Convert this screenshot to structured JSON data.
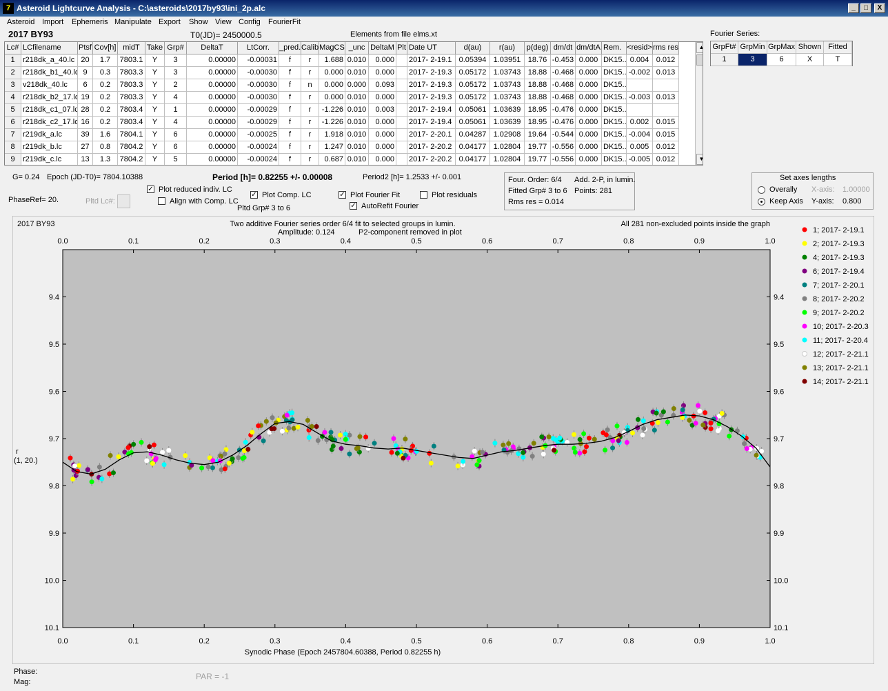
{
  "window": {
    "title": "Asteroid Lightcurve Analysis - C:\\asteroids\\2017by93\\ini_2p.alc",
    "icon": "7",
    "min": "_",
    "max": "□",
    "close": "X"
  },
  "menu": [
    "Asteroid",
    "Import",
    "Ephemeris",
    "Manipulate",
    "Export",
    "Show",
    "View",
    "Config",
    "FourierFit"
  ],
  "header": {
    "asteroid": "2017 BY93",
    "t0": "T0(JD)= 2450000.5",
    "elements": "Elements from file elms.xt"
  },
  "table": {
    "columns": [
      "Lc#",
      "LCfilename",
      "Ptsf",
      "Cov[h]",
      "midT",
      "Take",
      "Grp#",
      "DeltaT",
      "LtCorr.",
      "_pred.",
      "Calib.",
      "MagCS",
      "_unc",
      "DeltaM",
      "Plt",
      "Date UT",
      "d(au)",
      "r(au)",
      "p(deg)",
      "dm/dt",
      "dm/dtA",
      "Rem.",
      "<resid>",
      "rms res"
    ],
    "rows": [
      [
        "1",
        "r218dk_a_40.lc",
        "20",
        "1.7",
        "7803.1",
        "Y",
        "3",
        "0.00000",
        "-0.00031",
        "f",
        "r",
        "1.688",
        "0.010",
        "0.000",
        "",
        "2017- 2-19.1",
        "0.05394",
        "1.03951",
        "18.76",
        "-0.453",
        "0.000",
        "DK15..",
        "0.004",
        "0.012"
      ],
      [
        "2",
        "r218dk_b1_40.lc",
        "9",
        "0.3",
        "7803.3",
        "Y",
        "3",
        "0.00000",
        "-0.00030",
        "f",
        "r",
        "0.000",
        "0.010",
        "0.000",
        "",
        "2017- 2-19.3",
        "0.05172",
        "1.03743",
        "18.88",
        "-0.468",
        "0.000",
        "DK15..",
        "-0.002",
        "0.013"
      ],
      [
        "3",
        "v218dk_40.lc",
        "6",
        "0.2",
        "7803.3",
        "Y",
        "2",
        "0.00000",
        "-0.00030",
        "f",
        "n",
        "0.000",
        "0.000",
        "0.093",
        "",
        "2017- 2-19.3",
        "0.05172",
        "1.03743",
        "18.88",
        "-0.468",
        "0.000",
        "DK15..",
        "",
        ""
      ],
      [
        "4",
        "r218dk_b2_17.lc",
        "19",
        "0.2",
        "7803.3",
        "Y",
        "4",
        "0.00000",
        "-0.00030",
        "f",
        "r",
        "0.000",
        "0.010",
        "0.000",
        "",
        "2017- 2-19.3",
        "0.05172",
        "1.03743",
        "18.88",
        "-0.468",
        "0.000",
        "DK15..",
        "-0.003",
        "0.013"
      ],
      [
        "5",
        "r218dk_c1_07.lc",
        "28",
        "0.2",
        "7803.4",
        "Y",
        "1",
        "0.00000",
        "-0.00029",
        "f",
        "r",
        "-1.226",
        "0.010",
        "0.003",
        "",
        "2017- 2-19.4",
        "0.05061",
        "1.03639",
        "18.95",
        "-0.476",
        "0.000",
        "DK15..",
        "",
        ""
      ],
      [
        "6",
        "r218dk_c2_17.lc",
        "16",
        "0.2",
        "7803.4",
        "Y",
        "4",
        "0.00000",
        "-0.00029",
        "f",
        "r",
        "-1.226",
        "0.010",
        "0.000",
        "",
        "2017- 2-19.4",
        "0.05061",
        "1.03639",
        "18.95",
        "-0.476",
        "0.000",
        "DK15..",
        "0.002",
        "0.015"
      ],
      [
        "7",
        "r219dk_a.lc",
        "39",
        "1.6",
        "7804.1",
        "Y",
        "6",
        "0.00000",
        "-0.00025",
        "f",
        "r",
        "1.918",
        "0.010",
        "0.000",
        "",
        "2017- 2-20.1",
        "0.04287",
        "1.02908",
        "19.64",
        "-0.544",
        "0.000",
        "DK15..",
        "-0.004",
        "0.015"
      ],
      [
        "8",
        "r219dk_b.lc",
        "27",
        "0.8",
        "7804.2",
        "Y",
        "6",
        "0.00000",
        "-0.00024",
        "f",
        "r",
        "1.247",
        "0.010",
        "0.000",
        "",
        "2017- 2-20.2",
        "0.04177",
        "1.02804",
        "19.77",
        "-0.556",
        "0.000",
        "DK15..",
        "0.005",
        "0.012"
      ],
      [
        "9",
        "r219dk_c.lc",
        "13",
        "1.3",
        "7804.2",
        "Y",
        "5",
        "0.00000",
        "-0.00024",
        "f",
        "r",
        "0.687",
        "0.010",
        "0.000",
        "",
        "2017- 2-20.2",
        "0.04177",
        "1.02804",
        "19.77",
        "-0.556",
        "0.000",
        "DK15..",
        "-0.005",
        "0.012"
      ]
    ]
  },
  "fourier": {
    "title": "Fourier Series:",
    "columns": [
      "GrpFt#",
      "GrpMin",
      "GrpMax",
      "Shown",
      "Fitted"
    ],
    "row": [
      "1",
      "3",
      "6",
      "X",
      "T"
    ]
  },
  "params": {
    "g": "G= 0.24",
    "epoch": "Epoch (JD-T0)= 7804.10388",
    "period": "Period [h]= 0.82255 +/- 0.00008",
    "period2": "Period2 [h]= 1.2533 +/- 0.001",
    "phaseref": "PhaseRef= 20.",
    "pltd_lc": "Pltd Lc#:",
    "plot_reduced": "Plot reduced indiv. LC",
    "align_comp": "Align with Comp. LC",
    "plot_comp": "Plot Comp. LC",
    "pltd_grp": "Pltd Grp#  3   to   6",
    "plot_fourier": "Plot Fourier Fit",
    "autorefit": "AutoRefit Fourier",
    "plot_residuals": "Plot residuals",
    "check": "✓"
  },
  "info": {
    "order": "Four. Order:  6/4",
    "add": "Add. 2-P, in lumin.",
    "fitted": "Fitted Grp# 3 to 6",
    "points": "Points: 281",
    "rms": "Rms res     = 0.014"
  },
  "axes": {
    "title": "Set axes lengths",
    "overally": "Overally",
    "keep": "Keep Axis",
    "xaxis": "X-axis:",
    "xval": "1.00000",
    "yaxis": "Y-axis:",
    "yval": "0.800"
  },
  "chart_data": {
    "type": "scatter",
    "object": "2017 BY93",
    "title": "Two additive Fourier series order 6/4 fit to selected groups in lumin.",
    "amplitude": "Amplitude: 0.124",
    "p2note": "P2-component removed in plot",
    "points_note": "All 281 non-excluded points inside the graph",
    "xlabel": "Synodic Phase (Epoch 2457804.60388, Period 0.82255 h)",
    "ylabel": "r",
    "ylabel2": "(1, 20.)",
    "xlim": [
      0,
      1
    ],
    "ylim": [
      9.3,
      10.1
    ],
    "x_ticks": [
      "0.0",
      "0.1",
      "0.2",
      "0.3",
      "0.4",
      "0.5",
      "0.6",
      "0.7",
      "0.8",
      "0.9",
      "1.0"
    ],
    "y_ticks": [
      "9.4",
      "9.5",
      "9.6",
      "9.7",
      "9.8",
      "9.9",
      "10.0",
      "10.1"
    ],
    "background": "#c0c0c0",
    "fit_curve": {
      "x": [
        0,
        0.02,
        0.04,
        0.06,
        0.08,
        0.1,
        0.12,
        0.14,
        0.16,
        0.18,
        0.2,
        0.22,
        0.24,
        0.26,
        0.28,
        0.3,
        0.32,
        0.34,
        0.36,
        0.38,
        0.4,
        0.42,
        0.44,
        0.46,
        0.48,
        0.5,
        0.52,
        0.54,
        0.56,
        0.58,
        0.6,
        0.62,
        0.64,
        0.66,
        0.68,
        0.7,
        0.72,
        0.74,
        0.76,
        0.78,
        0.8,
        0.82,
        0.84,
        0.86,
        0.88,
        0.9,
        0.92,
        0.94,
        0.96,
        0.98,
        1.0
      ],
      "y": [
        9.75,
        9.77,
        9.775,
        9.765,
        9.745,
        9.73,
        9.728,
        9.735,
        9.745,
        9.752,
        9.755,
        9.75,
        9.735,
        9.715,
        9.69,
        9.668,
        9.664,
        9.67,
        9.688,
        9.705,
        9.712,
        9.715,
        9.72,
        9.722,
        9.72,
        9.725,
        9.73,
        9.735,
        9.74,
        9.742,
        9.735,
        9.728,
        9.725,
        9.72,
        9.715,
        9.712,
        9.712,
        9.71,
        9.706,
        9.698,
        9.685,
        9.67,
        9.66,
        9.655,
        9.65,
        9.652,
        9.66,
        9.675,
        9.695,
        9.72,
        9.76
      ]
    },
    "series": [
      {
        "name": "1; 2017- 2-19.1",
        "color": "#ff0000"
      },
      {
        "name": "2; 2017- 2-19.3",
        "color": "#ffff00"
      },
      {
        "name": "4; 2017- 2-19.3",
        "color": "#008000"
      },
      {
        "name": "6; 2017- 2-19.4",
        "color": "#800080"
      },
      {
        "name": "7; 2017- 2-20.1",
        "color": "#008080"
      },
      {
        "name": "8; 2017- 2-20.2",
        "color": "#808080"
      },
      {
        "name": "9; 2017- 2-20.2",
        "color": "#00ff00"
      },
      {
        "name": "10; 2017- 2-20.3",
        "color": "#ff00ff"
      },
      {
        "name": "11; 2017- 2-20.4",
        "color": "#00ffff"
      },
      {
        "name": "12; 2017- 2-21.1",
        "color": "#ffffff"
      },
      {
        "name": "13; 2017- 2-21.1",
        "color": "#808000"
      },
      {
        "name": "14; 2017- 2-21.1",
        "color": "#800000"
      }
    ]
  },
  "status": {
    "phase": "Phase:",
    "mag": "Mag:",
    "par": "PAR = -1"
  }
}
